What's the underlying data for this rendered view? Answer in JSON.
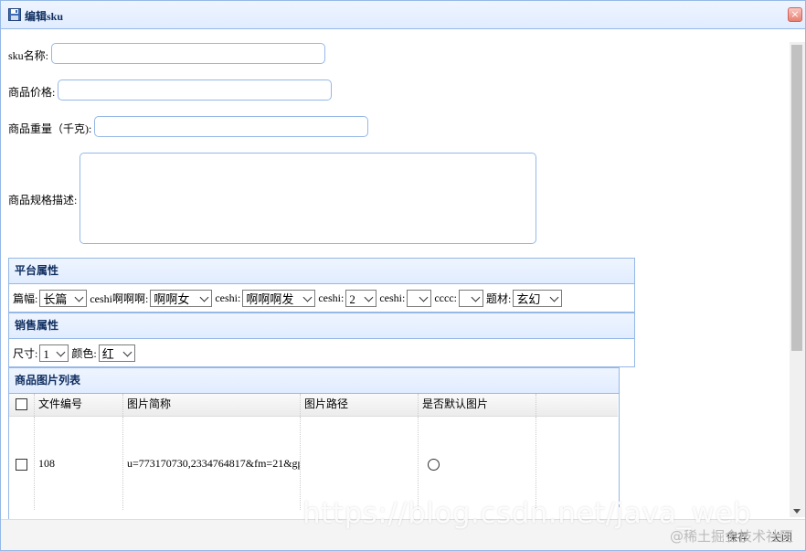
{
  "window": {
    "title": "编辑sku",
    "close_glyph": "×"
  },
  "form": {
    "sku_name_label": "sku名称:",
    "sku_name_value": "",
    "price_label": "商品价格:",
    "price_value": "",
    "weight_label": "商品重量（千克):",
    "weight_value": "",
    "spec_desc_label": "商品规格描述:",
    "spec_desc_value": ""
  },
  "platform_attrs": {
    "title": "平台属性",
    "items": [
      {
        "label": "篇幅:",
        "value": "长篇"
      },
      {
        "label": "ceshi啊啊啊:",
        "value": "啊啊女"
      },
      {
        "label": "ceshi:",
        "value": "啊啊啊发"
      },
      {
        "label": "ceshi:",
        "value": "2"
      },
      {
        "label": "ceshi:",
        "value": ""
      },
      {
        "label": "cccc:",
        "value": ""
      },
      {
        "label": "题材:",
        "value": "玄幻"
      }
    ]
  },
  "sale_attrs": {
    "title": "销售属性",
    "items": [
      {
        "label": "尺寸:",
        "value": "1"
      },
      {
        "label": "颜色:",
        "value": "红"
      }
    ]
  },
  "images": {
    "title": "商品图片列表",
    "columns": [
      "文件编号",
      "图片简称",
      "图片路径",
      "是否默认图片"
    ],
    "rows": [
      {
        "file_id": "108",
        "short_name": "u=773170730,2334764817&fm=21&gp",
        "path": "",
        "default": false
      }
    ]
  },
  "footer": {
    "save_label": "保存",
    "close_label": "关闭"
  },
  "watermark": {
    "text": "https://blog.csdn.net/java_web",
    "text2": "@稀土掘金技术社区"
  },
  "colors": {
    "border": "#95b8e7",
    "header_bg": "#e0ecff",
    "title_text": "#0e2d5f"
  }
}
